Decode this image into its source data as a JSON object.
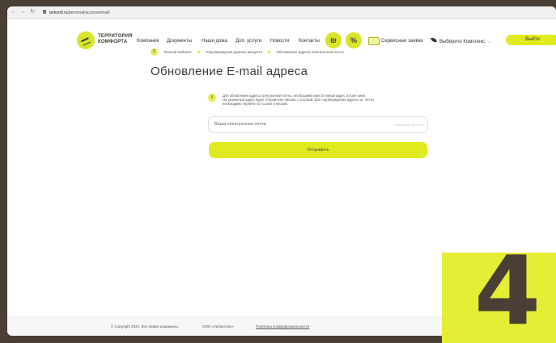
{
  "browser": {
    "url_domain": "terkomf.ru",
    "url_path": "/personal/access/email/"
  },
  "header": {
    "logo_line1": "ТЕРРИТОРИЯ",
    "logo_line2": "КОМФОРТА",
    "menu": [
      "Компания",
      "Документы",
      "Наши дома",
      "Доп. услуги",
      "Новости",
      "Контакты"
    ],
    "service_label": "Сервисные заявки",
    "complex_label": "Выберите Комплекс",
    "exit_label": "Выйти"
  },
  "breadcrumb": {
    "step": "2",
    "items": [
      "Личный Кабинет",
      "Подтверждение данных аккаунта",
      "Обновление адреса электронной почты"
    ]
  },
  "page": {
    "title": "Обновление E-mail адреса",
    "info_line1": "Для обновления адреса электронной почты, необходимо ввести новый адрес в поле ниже.",
    "info_line2": "На указанный адрес будет отправлено письмо с ссылкой. Для подтверждения адреса эл. почты",
    "info_line3": "необходимо перейти по ссылке в письме.",
    "email_placeholder": "Ваша электронная почта",
    "required_label": "Обязательное поле",
    "submit_label": "Отправить"
  },
  "footer": {
    "copyright": "© Copyright 2021. Все права защищены.",
    "company": "ООО «УрбанАгро»",
    "policy": "Политика конфиденциальности"
  },
  "overlay": {
    "step_number": "4"
  },
  "colors": {
    "accent": "#dfeb1e",
    "background": "#4a3f35"
  }
}
